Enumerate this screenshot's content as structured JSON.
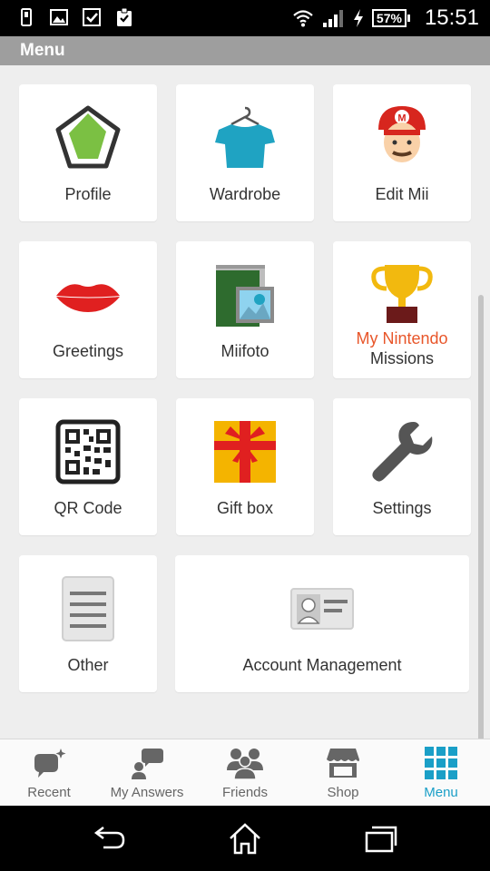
{
  "status_bar": {
    "battery": "57%",
    "time": "15:51"
  },
  "header": {
    "title": "Menu"
  },
  "tiles": [
    {
      "label": "Profile",
      "icon": "profile-pentagon-icon"
    },
    {
      "label": "Wardrobe",
      "icon": "shirt-hanger-icon"
    },
    {
      "label": "Edit Mii",
      "icon": "mii-face-icon"
    },
    {
      "label": "Greetings",
      "icon": "lips-icon"
    },
    {
      "label": "Miifoto",
      "icon": "photo-book-icon"
    },
    {
      "label_line1": "My Nintendo",
      "label_line2": "Missions",
      "icon": "trophy-icon"
    },
    {
      "label": "QR Code",
      "icon": "qr-code-icon"
    },
    {
      "label": "Gift box",
      "icon": "gift-box-icon"
    },
    {
      "label": "Settings",
      "icon": "wrench-icon"
    },
    {
      "label": "Other",
      "icon": "document-icon"
    },
    {
      "label": "Account Management",
      "icon": "id-card-icon"
    }
  ],
  "tabs": [
    {
      "label": "Recent",
      "icon": "recent-bubble-icon"
    },
    {
      "label": "My Answers",
      "icon": "my-answers-icon"
    },
    {
      "label": "Friends",
      "icon": "friends-icon"
    },
    {
      "label": "Shop",
      "icon": "shop-icon"
    },
    {
      "label": "Menu",
      "icon": "grid-menu-icon",
      "active": true
    }
  ],
  "colors": {
    "accent": "#1a9fc7",
    "mission_orange": "#e8562a",
    "header_gray": "#9e9e9e"
  }
}
